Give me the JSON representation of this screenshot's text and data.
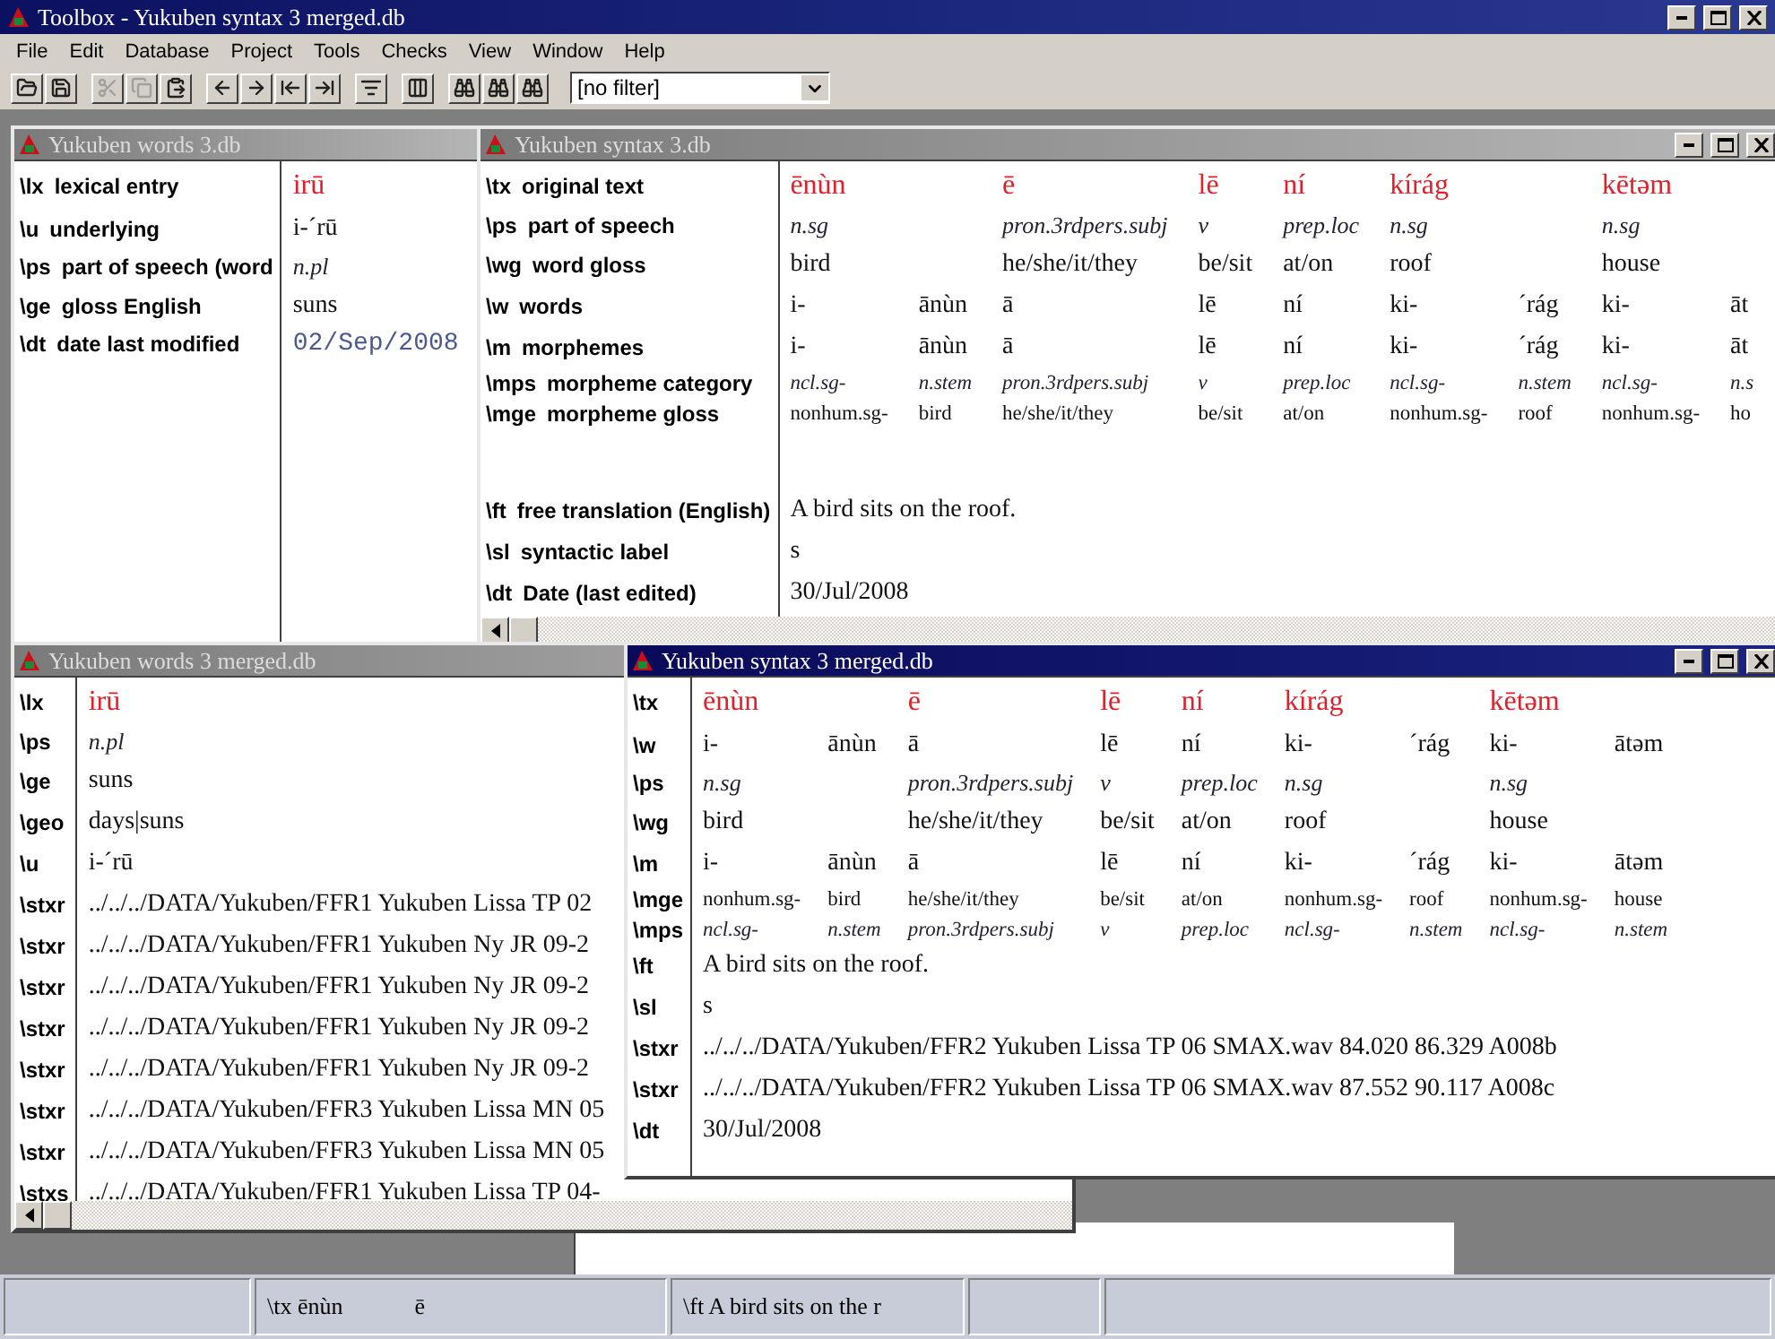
{
  "window": {
    "title": "Toolbox - Yukuben syntax 3 merged.db"
  },
  "menu": [
    "File",
    "Edit",
    "Database",
    "Project",
    "Tools",
    "Checks",
    "View",
    "Window",
    "Help"
  ],
  "toolbar": {
    "buttons": [
      {
        "kind": "open",
        "disabled": false
      },
      {
        "kind": "save",
        "disabled": false
      },
      {
        "kind": "cut",
        "disabled": true
      },
      {
        "kind": "copy",
        "disabled": true
      },
      {
        "kind": "paste",
        "disabled": false
      },
      {
        "kind": "back",
        "disabled": false
      },
      {
        "kind": "forward",
        "disabled": false
      },
      {
        "kind": "first",
        "disabled": false
      },
      {
        "kind": "last",
        "disabled": false
      },
      {
        "kind": "sort",
        "disabled": false
      },
      {
        "kind": "panes",
        "disabled": false
      },
      {
        "kind": "findprev",
        "disabled": false
      },
      {
        "kind": "find",
        "disabled": false
      },
      {
        "kind": "findnext",
        "disabled": false
      }
    ],
    "filter": "[no filter]"
  },
  "windows": [
    {
      "title": "Yukuben words 3.db",
      "active": false,
      "controls": false,
      "scrollbar": false,
      "lines": [
        {
          "kind": "head",
          "marker": "\\lx",
          "label": "lexical entry",
          "value": "irū"
        },
        {
          "kind": "text",
          "marker": "\\u",
          "label": "underlying",
          "value": "i-´rū"
        },
        {
          "kind": "cat",
          "marker": "\\ps",
          "label": "part of speech (word",
          "value": "n.pl"
        },
        {
          "kind": "text",
          "marker": "\\ge",
          "label": "gloss English",
          "value": "suns"
        },
        {
          "kind": "date",
          "marker": "\\dt",
          "label": "date last modified",
          "value": "02/Sep/2008"
        }
      ]
    },
    {
      "title": "Yukuben syntax 3.db",
      "active": false,
      "controls": true,
      "scrollbar": true,
      "word_starts": [
        true,
        false,
        true,
        true,
        true,
        true,
        false,
        true,
        false
      ],
      "lines": [
        {
          "kind": "wordhead",
          "marker": "\\tx",
          "label": "original text",
          "cells": [
            "ēnùn",
            "ē",
            "lē",
            "ní",
            "kírág",
            "kētəm"
          ]
        },
        {
          "kind": "wordcat",
          "marker": "\\ps",
          "label": "part of speech",
          "cells": [
            "n.sg",
            "pron.3rdpers.subj",
            "v",
            "prep.loc",
            "n.sg",
            "n.sg"
          ]
        },
        {
          "kind": "wordgloss",
          "marker": "\\wg",
          "label": "word gloss",
          "cells": [
            "bird",
            "he/she/it/they",
            "be/sit",
            "at/on",
            "roof",
            "house"
          ]
        },
        {
          "kind": "morph",
          "marker": "\\w",
          "label": "words",
          "cells": [
            "i-",
            "ānùn",
            "ā",
            "lē",
            "ní",
            "ki-",
            "´rág",
            "ki-",
            "āt"
          ]
        },
        {
          "kind": "morph",
          "marker": "\\m",
          "label": "morphemes",
          "cells": [
            "i-",
            "ānùn",
            "ā",
            "lē",
            "ní",
            "ki-",
            "´rág",
            "ki-",
            "āt"
          ]
        },
        {
          "kind": "morphcat",
          "marker": "\\mps",
          "label": "morpheme category",
          "cells": [
            "ncl.sg-",
            "n.stem",
            "pron.3rdpers.subj",
            "v",
            "prep.loc",
            "ncl.sg-",
            "n.stem",
            "ncl.sg-",
            "n.s"
          ]
        },
        {
          "kind": "morphgloss",
          "marker": "\\mge",
          "label": "morpheme gloss",
          "cells": [
            "nonhum.sg-",
            "bird",
            "he/she/it/they",
            "be/sit",
            "at/on",
            "nonhum.sg-",
            "roof",
            "nonhum.sg-",
            "ho"
          ]
        },
        {
          "kind": "blank"
        },
        {
          "kind": "text",
          "marker": "\\ft",
          "label": "free translation (English)",
          "value": "A bird sits on the roof."
        },
        {
          "kind": "text",
          "marker": "\\sl",
          "label": "syntactic label",
          "value": "s"
        },
        {
          "kind": "text",
          "marker": "\\dt",
          "label": "Date (last edited)",
          "value": "30/Jul/2008"
        }
      ]
    },
    {
      "title": "Yukuben words 3 merged.db",
      "active": false,
      "controls": false,
      "scrollbar": true,
      "lines": [
        {
          "kind": "head",
          "marker": "\\lx",
          "value": "irū"
        },
        {
          "kind": "cat",
          "marker": "\\ps",
          "value": "n.pl"
        },
        {
          "kind": "text",
          "marker": "\\ge",
          "value": "suns"
        },
        {
          "kind": "text",
          "marker": "\\geo",
          "value": "days|suns"
        },
        {
          "kind": "text",
          "marker": "\\u",
          "value": "i-´rū"
        },
        {
          "kind": "text",
          "marker": "\\stxr",
          "value": "../../../DATA/Yukuben/FFR1 Yukuben Lissa TP 02"
        },
        {
          "kind": "text",
          "marker": "\\stxr",
          "value": "../../../DATA/Yukuben/FFR1 Yukuben Ny JR 09-2"
        },
        {
          "kind": "text",
          "marker": "\\stxr",
          "value": "../../../DATA/Yukuben/FFR1 Yukuben Ny JR 09-2"
        },
        {
          "kind": "text",
          "marker": "\\stxr",
          "value": "../../../DATA/Yukuben/FFR1 Yukuben Ny JR 09-2"
        },
        {
          "kind": "text",
          "marker": "\\stxr",
          "value": "../../../DATA/Yukuben/FFR1 Yukuben Ny JR 09-2"
        },
        {
          "kind": "text",
          "marker": "\\stxr",
          "value": "../../../DATA/Yukuben/FFR3 Yukuben Lissa MN 05"
        },
        {
          "kind": "text",
          "marker": "\\stxr",
          "value": "../../../DATA/Yukuben/FFR3 Yukuben Lissa MN 05"
        },
        {
          "kind": "text",
          "marker": "\\stxs",
          "value": "../../../DATA/Yukuben/FFR1 Yukuben Lissa TP 04-"
        }
      ]
    },
    {
      "title": "Yukuben syntax 3 merged.db",
      "active": true,
      "controls": true,
      "scrollbar": false,
      "word_starts": [
        true,
        false,
        true,
        true,
        true,
        true,
        false,
        true,
        false
      ],
      "lines": [
        {
          "kind": "wordhead",
          "marker": "\\tx",
          "cells": [
            "ēnùn",
            "ē",
            "lē",
            "ní",
            "kírág",
            "kētəm"
          ]
        },
        {
          "kind": "morph",
          "marker": "\\w",
          "cells": [
            "i-",
            "ānùn",
            "ā",
            "lē",
            "ní",
            "ki-",
            "´rág",
            "ki-",
            "ātəm"
          ]
        },
        {
          "kind": "wordcat",
          "marker": "\\ps",
          "cells": [
            "n.sg",
            "pron.3rdpers.subj",
            "v",
            "prep.loc",
            "n.sg",
            "n.sg"
          ]
        },
        {
          "kind": "wordgloss",
          "marker": "\\wg",
          "cells": [
            "bird",
            "he/she/it/they",
            "be/sit",
            "at/on",
            "roof",
            "house"
          ]
        },
        {
          "kind": "morph",
          "marker": "\\m",
          "cells": [
            "i-",
            "ānùn",
            "ā",
            "lē",
            "ní",
            "ki-",
            "´rág",
            "ki-",
            "ātəm"
          ]
        },
        {
          "kind": "morphgloss",
          "marker": "\\mge",
          "cells": [
            "nonhum.sg-",
            "bird",
            "he/she/it/they",
            "be/sit",
            "at/on",
            "nonhum.sg-",
            "roof",
            "nonhum.sg-",
            "house"
          ]
        },
        {
          "kind": "morphcat",
          "marker": "\\mps",
          "cells": [
            "ncl.sg-",
            "n.stem",
            "pron.3rdpers.subj",
            "v",
            "prep.loc",
            "ncl.sg-",
            "n.stem",
            "ncl.sg-",
            "n.stem"
          ]
        },
        {
          "kind": "text",
          "marker": "\\ft",
          "value": "A bird sits on the roof."
        },
        {
          "kind": "text",
          "marker": "\\sl",
          "value": "s"
        },
        {
          "kind": "text",
          "marker": "\\stxr",
          "value": "../../../DATA/Yukuben/FFR2 Yukuben Lissa TP 06 SMAX.wav 84.020 86.329 A008b"
        },
        {
          "kind": "text",
          "marker": "\\stxr",
          "value": "../../../DATA/Yukuben/FFR2 Yukuben Lissa TP 06 SMAX.wav 87.552 90.117 A008c"
        },
        {
          "kind": "text",
          "marker": "\\dt",
          "value": "30/Jul/2008"
        }
      ]
    }
  ],
  "status_bar": {
    "record": [
      "\\tx ēnùn",
      "ē"
    ],
    "translation": "\\ft A bird sits on the r"
  }
}
